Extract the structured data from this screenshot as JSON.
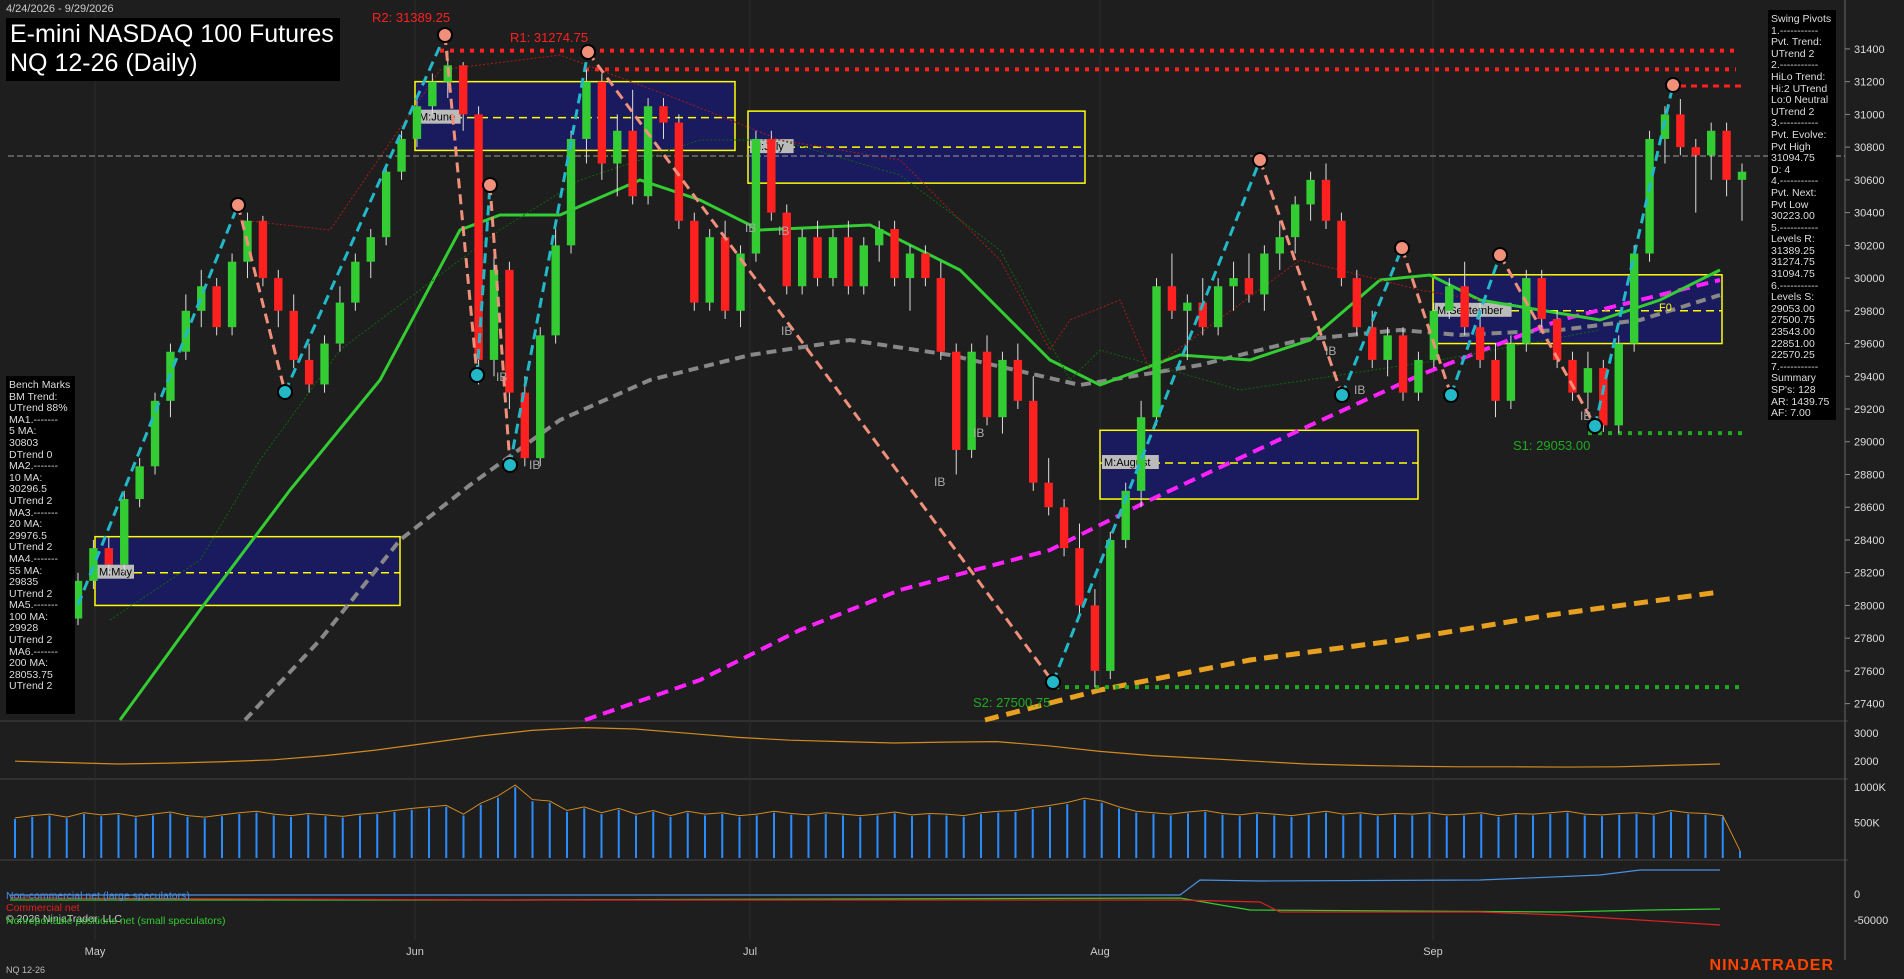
{
  "header": {
    "date_range": "4/24/2026 - 9/29/2026",
    "title_line1": "E-mini NASDAQ 100 Futures",
    "title_line2": "NQ 12-26 (Daily)"
  },
  "chart_data": [
    {
      "type": "candlestick",
      "panel": "price",
      "ylim": [
        27300,
        31650
      ],
      "y_ticks": [
        27400,
        27600,
        27800,
        28000,
        28200,
        28400,
        28600,
        28800,
        29000,
        29200,
        29400,
        29600,
        29800,
        30000,
        30200,
        30400,
        30600,
        30800,
        31000,
        31200,
        31400
      ],
      "x_labels": [
        "May",
        "Jun",
        "Jul",
        "Aug",
        "Sep"
      ],
      "candles": [
        {
          "o": 27920,
          "h": 28200,
          "l": 27880,
          "c": 28150
        },
        {
          "o": 28150,
          "h": 28400,
          "l": 28100,
          "c": 28350
        },
        {
          "o": 28350,
          "h": 28420,
          "l": 28200,
          "c": 28250
        },
        {
          "o": 28250,
          "h": 28700,
          "l": 28200,
          "c": 28650
        },
        {
          "o": 28650,
          "h": 28900,
          "l": 28600,
          "c": 28850
        },
        {
          "o": 28850,
          "h": 29300,
          "l": 28800,
          "c": 29250
        },
        {
          "o": 29250,
          "h": 29600,
          "l": 29150,
          "c": 29550
        },
        {
          "o": 29550,
          "h": 29900,
          "l": 29500,
          "c": 29800
        },
        {
          "o": 29800,
          "h": 30050,
          "l": 29700,
          "c": 29950
        },
        {
          "o": 29950,
          "h": 30000,
          "l": 29650,
          "c": 29700
        },
        {
          "o": 29700,
          "h": 30150,
          "l": 29650,
          "c": 30100
        },
        {
          "o": 30100,
          "h": 30400,
          "l": 30000,
          "c": 30350
        },
        {
          "o": 30350,
          "h": 30380,
          "l": 29950,
          "c": 30000
        },
        {
          "o": 30000,
          "h": 30050,
          "l": 29700,
          "c": 29800
        },
        {
          "o": 29800,
          "h": 29900,
          "l": 29450,
          "c": 29500
        },
        {
          "o": 29500,
          "h": 29600,
          "l": 29300,
          "c": 29350
        },
        {
          "o": 29350,
          "h": 29650,
          "l": 29300,
          "c": 29600
        },
        {
          "o": 29600,
          "h": 29950,
          "l": 29550,
          "c": 29850
        },
        {
          "o": 29850,
          "h": 30150,
          "l": 29800,
          "c": 30100
        },
        {
          "o": 30100,
          "h": 30300,
          "l": 30000,
          "c": 30250
        },
        {
          "o": 30250,
          "h": 30700,
          "l": 30200,
          "c": 30650
        },
        {
          "o": 30650,
          "h": 30900,
          "l": 30600,
          "c": 30850
        },
        {
          "o": 30850,
          "h": 31100,
          "l": 30800,
          "c": 31050
        },
        {
          "o": 31050,
          "h": 31250,
          "l": 31000,
          "c": 31200
        },
        {
          "o": 31200,
          "h": 31389,
          "l": 31100,
          "c": 31300
        },
        {
          "o": 31300,
          "h": 31320,
          "l": 30900,
          "c": 31000
        },
        {
          "o": 31000,
          "h": 31050,
          "l": 29350,
          "c": 29500
        },
        {
          "o": 29500,
          "h": 30150,
          "l": 29400,
          "c": 30050
        },
        {
          "o": 30050,
          "h": 30100,
          "l": 29200,
          "c": 29300
        },
        {
          "o": 29300,
          "h": 29400,
          "l": 28850,
          "c": 28900
        },
        {
          "o": 28900,
          "h": 29700,
          "l": 28850,
          "c": 29650
        },
        {
          "o": 29650,
          "h": 30300,
          "l": 29600,
          "c": 30200
        },
        {
          "o": 30200,
          "h": 30900,
          "l": 30150,
          "c": 30850
        },
        {
          "o": 30850,
          "h": 31274,
          "l": 30700,
          "c": 31200
        },
        {
          "o": 31200,
          "h": 31250,
          "l": 30600,
          "c": 30700
        },
        {
          "o": 30700,
          "h": 31000,
          "l": 30500,
          "c": 30900
        },
        {
          "o": 30900,
          "h": 31150,
          "l": 30450,
          "c": 30500
        },
        {
          "o": 30500,
          "h": 31100,
          "l": 30450,
          "c": 31050
        },
        {
          "o": 31050,
          "h": 31100,
          "l": 30850,
          "c": 30950
        },
        {
          "o": 30950,
          "h": 31000,
          "l": 30300,
          "c": 30350
        },
        {
          "o": 30350,
          "h": 30400,
          "l": 29800,
          "c": 29850
        },
        {
          "o": 29850,
          "h": 30300,
          "l": 29800,
          "c": 30250
        },
        {
          "o": 30250,
          "h": 30350,
          "l": 29750,
          "c": 29800
        },
        {
          "o": 29800,
          "h": 30200,
          "l": 29700,
          "c": 30150
        },
        {
          "o": 30150,
          "h": 30900,
          "l": 30100,
          "c": 30850
        },
        {
          "o": 30850,
          "h": 30900,
          "l": 30350,
          "c": 30400
        },
        {
          "o": 30400,
          "h": 30450,
          "l": 29900,
          "c": 29950
        },
        {
          "o": 29950,
          "h": 30300,
          "l": 29900,
          "c": 30250
        },
        {
          "o": 30250,
          "h": 30350,
          "l": 29950,
          "c": 30000
        },
        {
          "o": 30000,
          "h": 30300,
          "l": 29950,
          "c": 30250
        },
        {
          "o": 30250,
          "h": 30350,
          "l": 29900,
          "c": 29950
        },
        {
          "o": 29950,
          "h": 30250,
          "l": 29900,
          "c": 30200
        },
        {
          "o": 30200,
          "h": 30350,
          "l": 30100,
          "c": 30300
        },
        {
          "o": 30300,
          "h": 30350,
          "l": 29950,
          "c": 30000
        },
        {
          "o": 30000,
          "h": 30200,
          "l": 29800,
          "c": 30150
        },
        {
          "o": 30150,
          "h": 30200,
          "l": 29950,
          "c": 30000
        },
        {
          "o": 30000,
          "h": 30100,
          "l": 29500,
          "c": 29550
        },
        {
          "o": 29550,
          "h": 29600,
          "l": 28800,
          "c": 28950
        },
        {
          "o": 28950,
          "h": 29600,
          "l": 28900,
          "c": 29550
        },
        {
          "o": 29550,
          "h": 29650,
          "l": 29100,
          "c": 29150
        },
        {
          "o": 29150,
          "h": 29550,
          "l": 29050,
          "c": 29500
        },
        {
          "o": 29500,
          "h": 29600,
          "l": 29200,
          "c": 29250
        },
        {
          "o": 29250,
          "h": 29400,
          "l": 28700,
          "c": 28750
        },
        {
          "o": 28750,
          "h": 28900,
          "l": 28550,
          "c": 28600
        },
        {
          "o": 28600,
          "h": 28650,
          "l": 28300,
          "c": 28350
        },
        {
          "o": 28350,
          "h": 28500,
          "l": 27950,
          "c": 28000
        },
        {
          "o": 28000,
          "h": 28100,
          "l": 27500,
          "c": 27600
        },
        {
          "o": 27600,
          "h": 28450,
          "l": 27550,
          "c": 28400
        },
        {
          "o": 28400,
          "h": 28750,
          "l": 28350,
          "c": 28700
        },
        {
          "o": 28700,
          "h": 29250,
          "l": 28600,
          "c": 29150
        },
        {
          "o": 29150,
          "h": 30000,
          "l": 29100,
          "c": 29950
        },
        {
          "o": 29950,
          "h": 30150,
          "l": 29750,
          "c": 29800
        },
        {
          "o": 29800,
          "h": 29900,
          "l": 29500,
          "c": 29850
        },
        {
          "o": 29850,
          "h": 30000,
          "l": 29650,
          "c": 29700
        },
        {
          "o": 29700,
          "h": 30000,
          "l": 29650,
          "c": 29950
        },
        {
          "o": 29950,
          "h": 30100,
          "l": 29800,
          "c": 30000
        },
        {
          "o": 30000,
          "h": 30150,
          "l": 29850,
          "c": 29900
        },
        {
          "o": 29900,
          "h": 30200,
          "l": 29800,
          "c": 30150
        },
        {
          "o": 30150,
          "h": 30350,
          "l": 30050,
          "c": 30250
        },
        {
          "o": 30250,
          "h": 30500,
          "l": 30150,
          "c": 30450
        },
        {
          "o": 30450,
          "h": 30650,
          "l": 30350,
          "c": 30600
        },
        {
          "o": 30600,
          "h": 30700,
          "l": 30300,
          "c": 30350
        },
        {
          "o": 30350,
          "h": 30400,
          "l": 29950,
          "c": 30000
        },
        {
          "o": 30000,
          "h": 30050,
          "l": 29650,
          "c": 29700
        },
        {
          "o": 29700,
          "h": 29800,
          "l": 29450,
          "c": 29500
        },
        {
          "o": 29500,
          "h": 29700,
          "l": 29400,
          "c": 29650
        },
        {
          "o": 29650,
          "h": 29700,
          "l": 29250,
          "c": 29300
        },
        {
          "o": 29300,
          "h": 29550,
          "l": 29250,
          "c": 29500
        },
        {
          "o": 29500,
          "h": 29850,
          "l": 29450,
          "c": 29800
        },
        {
          "o": 29800,
          "h": 30000,
          "l": 29750,
          "c": 29950
        },
        {
          "o": 29950,
          "h": 30100,
          "l": 29650,
          "c": 29700
        },
        {
          "o": 29700,
          "h": 29850,
          "l": 29450,
          "c": 29500
        },
        {
          "o": 29500,
          "h": 29600,
          "l": 29150,
          "c": 29250
        },
        {
          "o": 29250,
          "h": 29650,
          "l": 29200,
          "c": 29600
        },
        {
          "o": 29600,
          "h": 30050,
          "l": 29550,
          "c": 30000
        },
        {
          "o": 30000,
          "h": 30050,
          "l": 29700,
          "c": 29750
        },
        {
          "o": 29750,
          "h": 29800,
          "l": 29450,
          "c": 29500
        },
        {
          "o": 29500,
          "h": 29550,
          "l": 29250,
          "c": 29300
        },
        {
          "o": 29300,
          "h": 29550,
          "l": 29200,
          "c": 29450
        },
        {
          "o": 29450,
          "h": 29500,
          "l": 29060,
          "c": 29100
        },
        {
          "o": 29100,
          "h": 29650,
          "l": 29053,
          "c": 29600
        },
        {
          "o": 29600,
          "h": 30200,
          "l": 29550,
          "c": 30150
        },
        {
          "o": 30150,
          "h": 30900,
          "l": 30100,
          "c": 30850
        },
        {
          "o": 30850,
          "h": 31050,
          "l": 30700,
          "c": 31000
        },
        {
          "o": 31000,
          "h": 31094,
          "l": 30750,
          "c": 30800
        },
        {
          "o": 30800,
          "h": 30850,
          "l": 30400,
          "c": 30750
        },
        {
          "o": 30750,
          "h": 30950,
          "l": 30600,
          "c": 30900
        },
        {
          "o": 30900,
          "h": 30950,
          "l": 30500,
          "c": 30600
        },
        {
          "o": 30600,
          "h": 30700,
          "l": 30350,
          "c": 30650
        }
      ],
      "levels": [
        {
          "label": "R2: 31389.25",
          "value": 31389.25,
          "color": "#ff2020"
        },
        {
          "label": "R1: 31274.75",
          "value": 31274.75,
          "color": "#ff2020"
        },
        {
          "label": "S1: 29053.00",
          "value": 29053.0,
          "color": "#1faa1f"
        },
        {
          "label": "S2: 27500.75",
          "value": 27500.75,
          "color": "#1faa1f"
        }
      ],
      "vwap_boxes": [
        {
          "label": "M:May",
          "top": 28420,
          "mid": 28200,
          "bottom": 28000
        },
        {
          "label": "M:June",
          "top": 31200,
          "mid": 30980,
          "bottom": 30780
        },
        {
          "label": "M:July",
          "top": 31020,
          "mid": 30800,
          "bottom": 30580
        },
        {
          "label": "M:August",
          "top": 29070,
          "mid": 28870,
          "bottom": 28650
        },
        {
          "label": "M:September",
          "top": 30020,
          "mid": 29800,
          "bottom": 29600
        }
      ],
      "annotations": [
        "IB",
        "F0"
      ],
      "moving_averages": [
        {
          "name": "10 MA",
          "color": "#33cc33"
        },
        {
          "name": "20 MA",
          "color": "#888888"
        },
        {
          "name": "100 MA",
          "color": "#ff22ff"
        },
        {
          "name": "200 MA",
          "color": "#e8a020"
        }
      ]
    },
    {
      "type": "line",
      "panel": "oscillator",
      "y_ticks": [
        2000,
        3000
      ],
      "ylim": [
        1400,
        3400
      ],
      "series": [
        {
          "values": [
            2000,
            1950,
            1900,
            1930,
            1980,
            2050,
            2200,
            2400,
            2650,
            2900,
            3100,
            3200,
            3150,
            3000,
            2850,
            2750,
            2700,
            2650,
            2680,
            2700,
            2550,
            2350,
            2200,
            2100,
            2000,
            1900,
            1850,
            1820,
            1800,
            1800,
            1790,
            1800,
            1850,
            1900
          ]
        }
      ]
    },
    {
      "type": "bar",
      "panel": "volume",
      "y_ticks_labels": [
        "500K",
        "1000K"
      ],
      "y_ticks": [
        500000,
        1000000
      ],
      "ylim": [
        0,
        1100000
      ],
      "values": [
        550000,
        580000,
        600000,
        560000,
        620000,
        590000,
        610000,
        570000,
        600000,
        630000,
        580000,
        560000,
        590000,
        620000,
        640000,
        600000,
        580000,
        610000,
        590000,
        570000,
        600000,
        620000,
        650000,
        680000,
        700000,
        720000,
        600000,
        750000,
        850000,
        1000000,
        800000,
        780000,
        650000,
        700000,
        620000,
        680000,
        600000,
        650000,
        580000,
        640000,
        600000,
        620000,
        580000,
        600000,
        640000,
        610000,
        590000,
        620000,
        600000,
        580000,
        600000,
        630000,
        590000,
        610000,
        600000,
        580000,
        620000,
        640000,
        650000,
        690000,
        720000,
        760000,
        820000,
        780000,
        700000,
        640000,
        620000,
        600000,
        630000,
        650000,
        610000,
        590000,
        620000,
        600000,
        580000,
        610000,
        640000,
        600000,
        620000,
        590000,
        610000,
        600000,
        620000,
        590000,
        600000,
        620000,
        580000,
        610000,
        600000,
        620000,
        640000,
        600000,
        590000,
        610000,
        620000,
        600000,
        650000,
        620000,
        610000,
        580000,
        100000
      ]
    },
    {
      "type": "line",
      "panel": "cot",
      "y_ticks": [
        -50000,
        0
      ],
      "series": [
        {
          "name": "Non-commercial net (large speculators)",
          "color": "#4a90e2"
        },
        {
          "name": "Commercial net",
          "color": "#e02020"
        },
        {
          "name": "Nonreportable positions net (small speculators)",
          "color": "#33cc33"
        }
      ]
    }
  ],
  "bench_marks": [
    "Bench Marks",
    "BM Trend:",
    "UTrend 88%",
    "MA1.-------",
    "5 MA:",
    "30803",
    "DTrend 0",
    "MA2.-------",
    "10 MA:",
    "30296.5",
    "UTrend 2",
    "MA3.-------",
    "20 MA:",
    "29976.5",
    "UTrend 2",
    "MA4.-------",
    "55 MA:",
    "29835",
    "UTrend 2",
    "MA5.-------",
    "100 MA:",
    "29928",
    "UTrend 2",
    "MA6.-------",
    "200 MA:",
    "28053.75",
    "UTrend 2"
  ],
  "swing_pivots": [
    "Swing Pivots",
    "1.-----------",
    "Pvt. Trend:",
    "UTrend 2",
    "2.-----------",
    "HiLo Trend:",
    "Hi:2 UTrend",
    "Lo:0 Neutral",
    "UTrend 2",
    "3.-----------",
    "Pvt. Evolve:",
    "Pvt High",
    "31094.75",
    "D: 4",
    "4.-----------",
    "Pvt. Next:",
    "Pvt Low",
    "30223.00",
    "5.-----------",
    "Levels R:",
    "31389.25",
    "31274.75",
    "31094.75",
    "6.-----------",
    "Levels S:",
    "29053.00",
    "27500.75",
    "23543.00",
    "22851.00",
    "22570.25",
    "7.-----------",
    "Summary",
    "SP's: 128",
    "AR: 1439.75",
    "AF: 7.00"
  ],
  "cot_legend": {
    "noncommercial": "Non-commercial net (large speculators)",
    "commercial": "Commercial net",
    "copyright": "© 2026 NinjaTrader, LLC",
    "nonreportable": "Nonreportable positions net (small speculators)"
  },
  "footer": {
    "symbol": "NQ 12-26",
    "brand": "NINJATRADER"
  },
  "colors": {
    "up": "#33cc33",
    "down": "#ff2020",
    "background": "#1e1e1e",
    "box_fill": "#1a1a5e",
    "box_border": "#ffff00"
  }
}
